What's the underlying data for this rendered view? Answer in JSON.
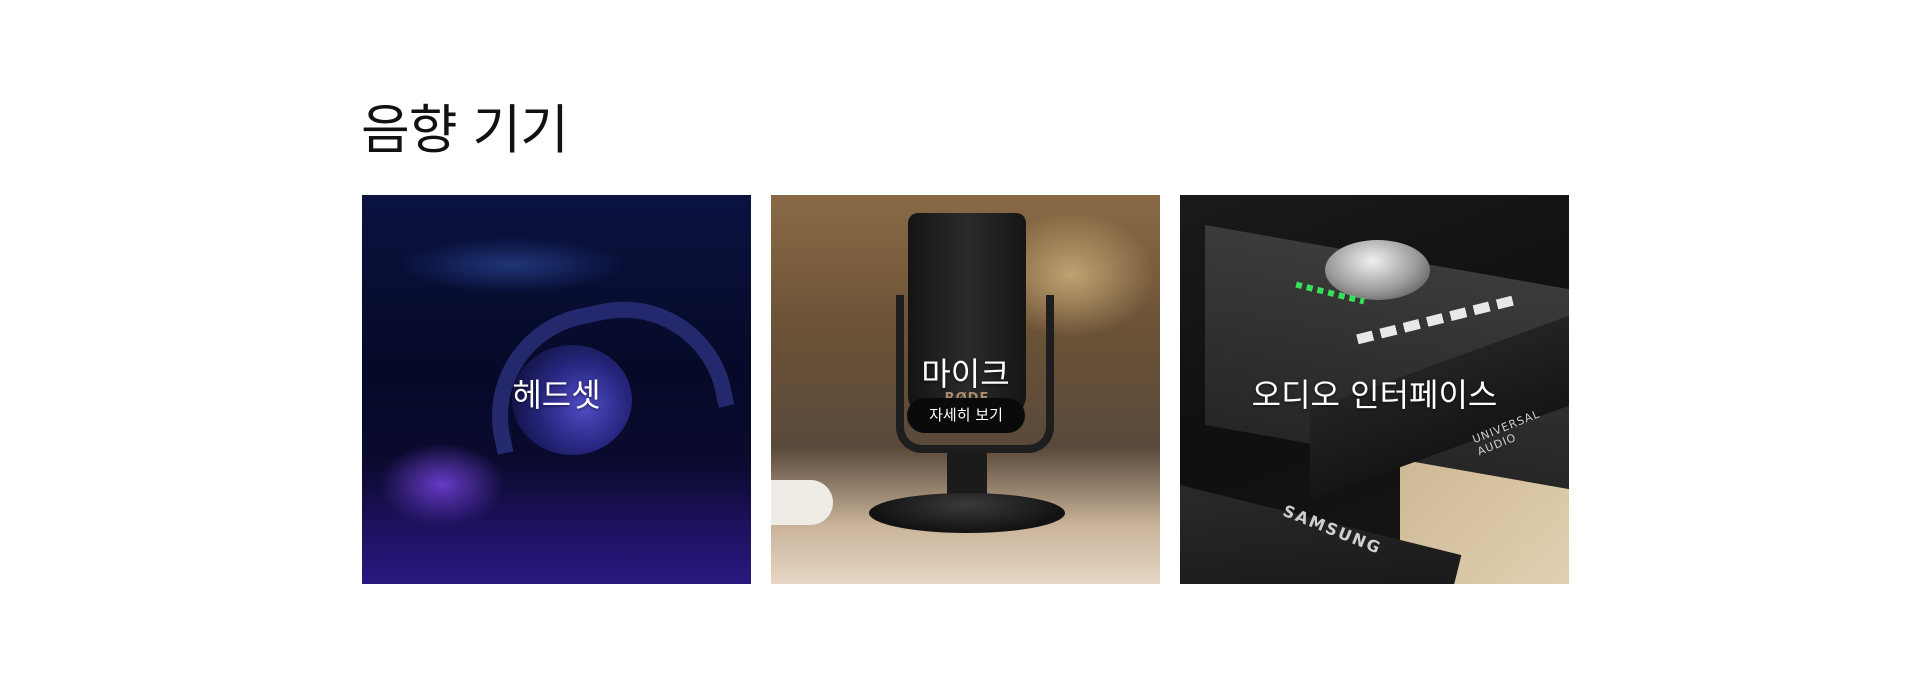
{
  "section": {
    "title": "음향 기기"
  },
  "cards": [
    {
      "label": "헤드셋",
      "image": "headphones-photo"
    },
    {
      "label": "마이크",
      "image": "microphone-photo",
      "mic_brand": "RØDE",
      "button_label": "자세히 보기"
    },
    {
      "label": "오디오 인터페이스",
      "image": "audio-interface-photo",
      "device_brand": "UNIVERSAL AUDIO",
      "ssd_brand": "SAMSUNG"
    }
  ]
}
